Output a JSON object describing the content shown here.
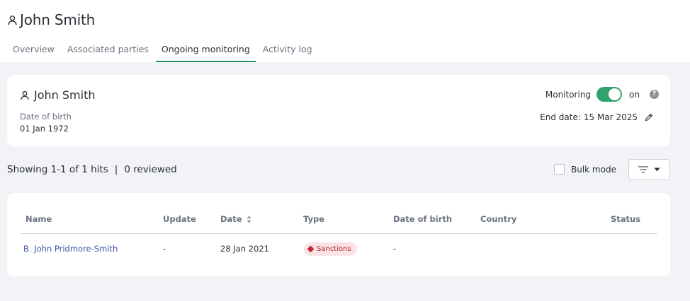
{
  "header": {
    "title": "John Smith",
    "tabs": [
      {
        "label": "Overview",
        "active": false
      },
      {
        "label": "Associated parties",
        "active": false
      },
      {
        "label": "Ongoing monitoring",
        "active": true
      },
      {
        "label": "Activity log",
        "active": false
      }
    ]
  },
  "subject": {
    "name": "John Smith",
    "dob_label": "Date of birth",
    "dob_value": "01 Jan 1972",
    "monitoring_label": "Monitoring",
    "monitoring_state": "on",
    "end_date_label": "End date:",
    "end_date_value": "15 Mar 2025"
  },
  "results_bar": {
    "showing": "Showing 1-1 of 1 hits",
    "separator": "|",
    "reviewed": "0 reviewed",
    "bulk_mode_label": "Bulk mode",
    "bulk_mode_checked": false
  },
  "table": {
    "columns": [
      "Name",
      "Update",
      "Date",
      "Type",
      "Date of birth",
      "Country",
      "Status"
    ],
    "rows": [
      {
        "name": "B. John Pridmore-Smith",
        "update": "-",
        "date": "28 Jan 2021",
        "type": "Sanctions",
        "dob": "-",
        "country": "",
        "status": ""
      }
    ]
  },
  "colors": {
    "accent_green": "#1e9a5c",
    "toggle_green": "#2fa36b",
    "link_blue": "#3c55a8",
    "sanctions_red": "#b3242f",
    "sanctions_bg": "#fbe3e5"
  }
}
